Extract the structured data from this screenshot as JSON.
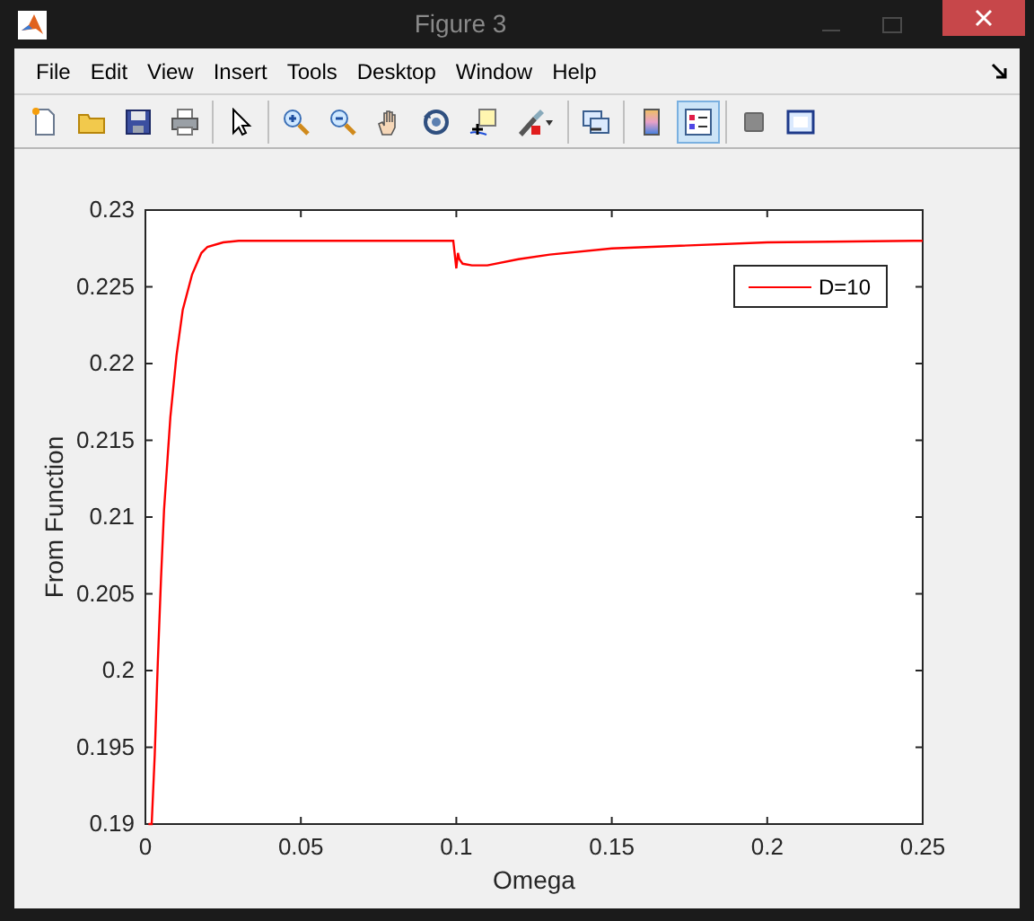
{
  "window": {
    "title": "Figure 3"
  },
  "menu": [
    "File",
    "Edit",
    "View",
    "Insert",
    "Tools",
    "Desktop",
    "Window",
    "Help"
  ],
  "toolbar_groups": [
    [
      {
        "kind": "new",
        "selected": false
      },
      {
        "kind": "open",
        "selected": false
      },
      {
        "kind": "save",
        "selected": false
      },
      {
        "kind": "print",
        "selected": false
      }
    ],
    [
      {
        "kind": "pointer",
        "selected": false
      }
    ],
    [
      {
        "kind": "zoom-in",
        "selected": false
      },
      {
        "kind": "zoom-out",
        "selected": false
      },
      {
        "kind": "pan",
        "selected": false
      },
      {
        "kind": "rotate",
        "selected": false
      },
      {
        "kind": "data-cursor",
        "selected": false
      },
      {
        "kind": "brush",
        "selected": false
      }
    ],
    [
      {
        "kind": "link",
        "selected": false
      }
    ],
    [
      {
        "kind": "colorbar",
        "selected": false
      },
      {
        "kind": "legend",
        "selected": true
      }
    ],
    [
      {
        "kind": "hide-tools",
        "selected": false
      },
      {
        "kind": "show-tools",
        "selected": false
      }
    ]
  ],
  "chart_data": {
    "type": "line",
    "xlabel": "Omega",
    "ylabel": "From Function",
    "xlim": [
      0,
      0.25
    ],
    "ylim": [
      0.19,
      0.23
    ],
    "xticks": [
      {
        "value": 0,
        "label": "0"
      },
      {
        "value": 0.05,
        "label": "0.05"
      },
      {
        "value": 0.1,
        "label": "0.1"
      },
      {
        "value": 0.15,
        "label": "0.15"
      },
      {
        "value": 0.2,
        "label": "0.2"
      },
      {
        "value": 0.25,
        "label": "0.25"
      }
    ],
    "yticks": [
      {
        "value": 0.19,
        "label": "0.19"
      },
      {
        "value": 0.195,
        "label": "0.195"
      },
      {
        "value": 0.2,
        "label": "0.2"
      },
      {
        "value": 0.205,
        "label": "0.205"
      },
      {
        "value": 0.21,
        "label": "0.21"
      },
      {
        "value": 0.215,
        "label": "0.215"
      },
      {
        "value": 0.22,
        "label": "0.22"
      },
      {
        "value": 0.225,
        "label": "0.225"
      },
      {
        "value": 0.23,
        "label": "0.23"
      }
    ],
    "x": [
      0.001,
      0.002,
      0.003,
      0.004,
      0.005,
      0.006,
      0.008,
      0.01,
      0.012,
      0.015,
      0.018,
      0.02,
      0.025,
      0.03,
      0.05,
      0.08,
      0.099,
      0.1,
      0.1005,
      0.101,
      0.102,
      0.105,
      0.11,
      0.12,
      0.13,
      0.15,
      0.2,
      0.25
    ],
    "series": [
      {
        "name": "D=10",
        "color": "#ff0000",
        "values": [
          0.19,
          0.19,
          0.1945,
          0.2005,
          0.206,
          0.2105,
          0.2165,
          0.2205,
          0.2235,
          0.2258,
          0.2272,
          0.2276,
          0.2279,
          0.228,
          0.228,
          0.228,
          0.228,
          0.2262,
          0.2272,
          0.2268,
          0.2265,
          0.2264,
          0.2264,
          0.2268,
          0.2271,
          0.2275,
          0.2279,
          0.228
        ]
      }
    ]
  }
}
